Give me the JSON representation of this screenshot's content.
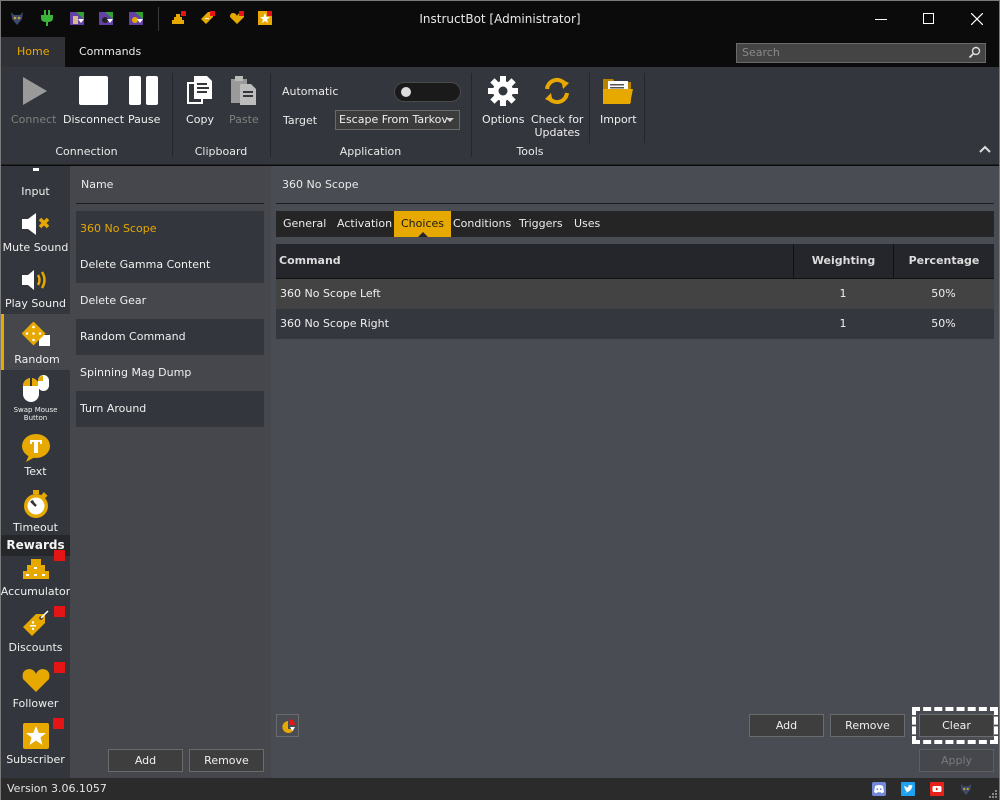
{
  "window": {
    "title": "InstructBot [Administrator]",
    "controls": {
      "minimize": "minimize",
      "maximize": "maximize",
      "close": "close"
    }
  },
  "quick_access": [
    {
      "name": "app-logo-icon"
    },
    {
      "name": "plug-icon"
    },
    {
      "name": "twitch-avatar-icon"
    },
    {
      "name": "twitch-bot-icon"
    },
    {
      "name": "twitch-accumulator-icon"
    },
    {
      "name": "accumulator-icon"
    },
    {
      "name": "discount-tag-icon"
    },
    {
      "name": "follower-heart-icon"
    },
    {
      "name": "subscriber-star-icon"
    }
  ],
  "ribbon_tabs": [
    {
      "label": "Home",
      "active": true
    },
    {
      "label": "Commands",
      "active": false
    }
  ],
  "search": {
    "placeholder": "Search",
    "value": ""
  },
  "ribbon": {
    "connection": {
      "label": "Connection",
      "buttons": [
        {
          "label": "Connect",
          "icon": "play-icon",
          "enabled": false
        },
        {
          "label": "Disconnect",
          "icon": "stop-icon",
          "enabled": true
        },
        {
          "label": "Pause",
          "icon": "pause-icon",
          "enabled": true
        }
      ]
    },
    "clipboard": {
      "label": "Clipboard",
      "buttons": [
        {
          "label": "Copy",
          "icon": "copy-icon",
          "enabled": true
        },
        {
          "label": "Paste",
          "icon": "paste-icon",
          "enabled": false
        }
      ]
    },
    "application": {
      "label": "Application",
      "automatic_label": "Automatic",
      "automatic_on": false,
      "target_label": "Target",
      "target_value": "Escape From Tarkov"
    },
    "tools": {
      "label": "Tools",
      "buttons": [
        {
          "label": "Options",
          "icon": "gear-icon"
        },
        {
          "label_line1": "Check for",
          "label_line2": "Updates",
          "icon": "refresh-icon"
        }
      ]
    },
    "import": {
      "label": "Import",
      "icon": "folder-icon"
    }
  },
  "sidebar": {
    "items": [
      {
        "label": "Input",
        "icon": "input-icon"
      },
      {
        "label": "Mute Sound",
        "icon": "mute-sound-icon"
      },
      {
        "label": "Play Sound",
        "icon": "play-sound-icon"
      },
      {
        "label": "Random",
        "icon": "dice-icon",
        "active": true
      },
      {
        "label_line1": "Swap Mouse",
        "label_line2": "Button",
        "icon": "mouse-icon"
      },
      {
        "label": "Text",
        "icon": "text-bubble-icon"
      },
      {
        "label": "Timeout",
        "icon": "stopwatch-icon"
      }
    ],
    "rewards_header": "Rewards",
    "rewards": [
      {
        "label": "Accumulator",
        "icon": "accumulator-icon",
        "badge": true
      },
      {
        "label": "Discounts",
        "icon": "discount-tag-icon",
        "badge": true
      },
      {
        "label": "Follower",
        "icon": "heart-icon",
        "badge": true
      },
      {
        "label": "Subscriber",
        "icon": "star-icon",
        "badge": true
      }
    ]
  },
  "command_list": {
    "header": "Name",
    "items": [
      {
        "label": "360 No Scope",
        "selected": true
      },
      {
        "label": "Delete Gamma Content"
      },
      {
        "label": "Delete Gear"
      },
      {
        "label": "Random Command"
      },
      {
        "label": "Spinning Mag Dump"
      },
      {
        "label": "Turn Around"
      }
    ],
    "add_label": "Add",
    "remove_label": "Remove"
  },
  "detail": {
    "title": "360 No Scope",
    "tabs": [
      {
        "label": "General"
      },
      {
        "label": "Activation"
      },
      {
        "label": "Choices",
        "active": true
      },
      {
        "label": "Conditions"
      },
      {
        "label": "Triggers"
      },
      {
        "label": "Uses"
      }
    ],
    "grid": {
      "columns": [
        "Command",
        "Weighting",
        "Percentage"
      ],
      "rows": [
        {
          "command": "360 No Scope Left",
          "weighting": "1",
          "percentage": "50%"
        },
        {
          "command": "360 No Scope Right",
          "weighting": "1",
          "percentage": "50%"
        }
      ]
    },
    "chart_button_icon": "pie-chart-icon",
    "add_label": "Add",
    "remove_label": "Remove",
    "clear_label": "Clear",
    "apply_label": "Apply"
  },
  "status_bar": {
    "version": "Version 3.06.1057",
    "links": [
      {
        "name": "discord-icon",
        "color": "#7289da"
      },
      {
        "name": "twitter-icon",
        "color": "#1da1f2"
      },
      {
        "name": "youtube-icon",
        "color": "#e62117"
      },
      {
        "name": "app-logo-icon",
        "color": "#3a4766"
      }
    ]
  },
  "colors": {
    "accent": "#e7a800",
    "badge": "#e51515",
    "panel": "#4a4c53",
    "ribbon": "#33363d"
  }
}
